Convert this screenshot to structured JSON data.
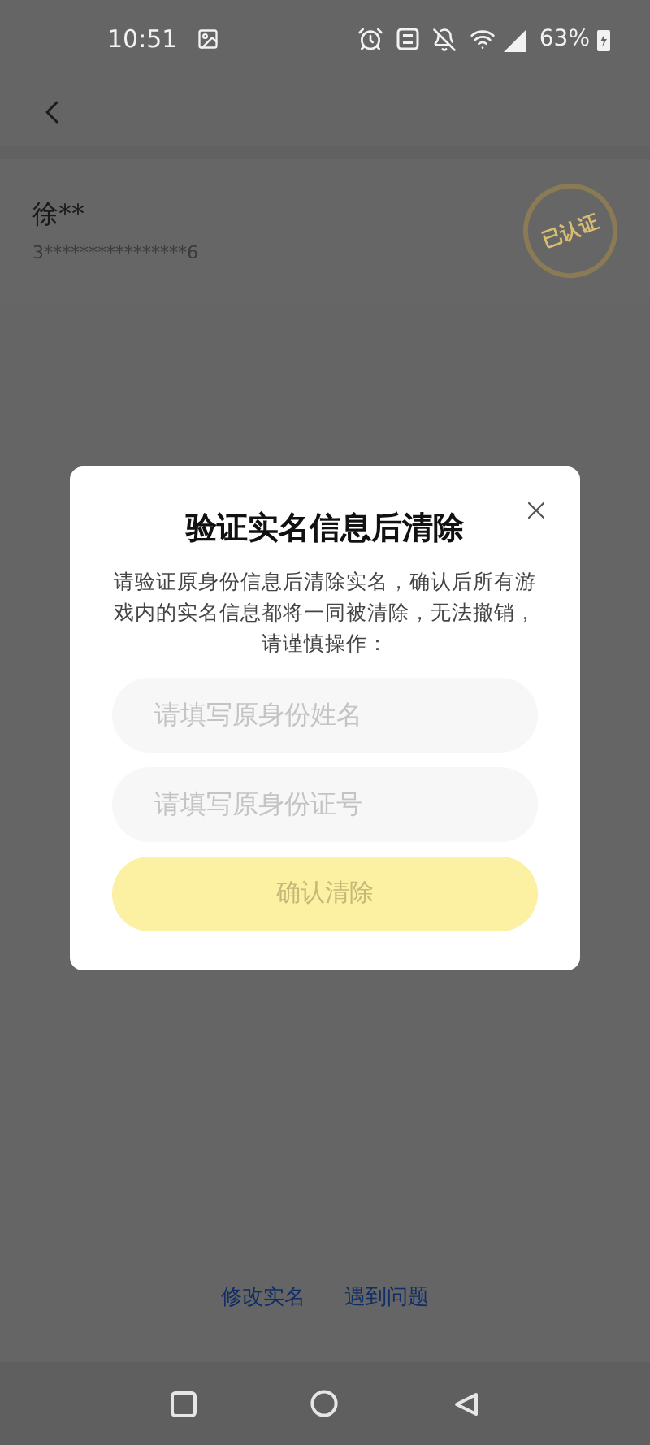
{
  "status_bar": {
    "time": "10:51",
    "battery": "63%"
  },
  "profile": {
    "name": "徐**",
    "id_number": "3****************6",
    "stamp": "已认证"
  },
  "dialog": {
    "title": "验证实名信息后清除",
    "message": "请验证原身份信息后清除实名，确认后所有游戏内的实名信息都将一同被清除，无法撤销，请谨慎操作：",
    "fields": [
      {
        "placeholder": "请填写原身份姓名"
      },
      {
        "placeholder": "请填写原身份证号"
      }
    ],
    "confirm": {
      "label": "确认清除",
      "disabled": true
    }
  },
  "links": [
    "修改实名",
    "遇到问题"
  ]
}
